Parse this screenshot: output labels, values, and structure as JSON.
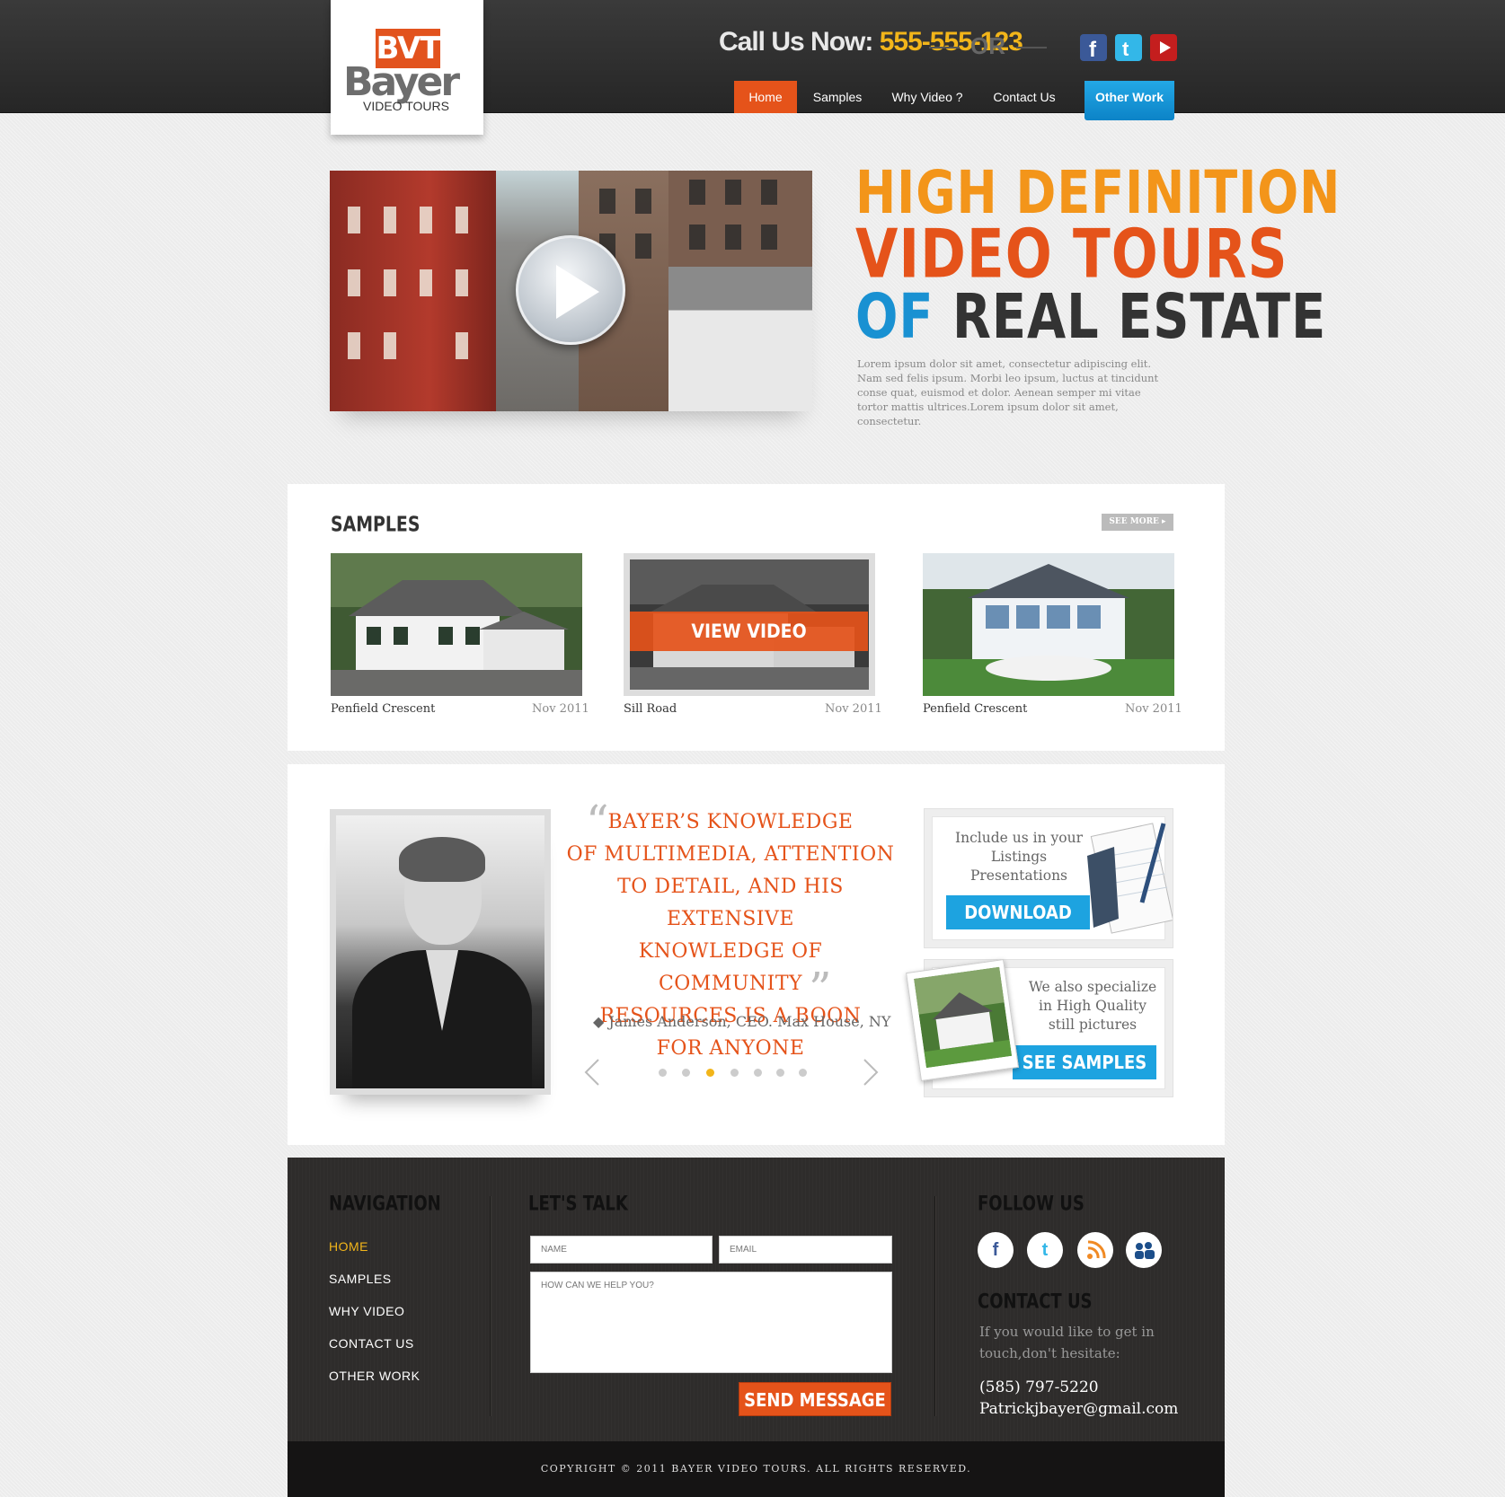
{
  "brand": {
    "logo_mark": "BVT",
    "logo_name": "Bayer",
    "logo_sub": "VIDEO TOURS"
  },
  "header": {
    "call_label": "Call Us Now:",
    "call_number": "555-555-123",
    "or_label": "OR",
    "social": [
      "facebook-icon",
      "twitter-icon",
      "youtube-icon"
    ]
  },
  "nav": {
    "items": [
      "Home",
      "Samples",
      "Why Video ?",
      "Contact Us",
      "Other Work"
    ],
    "active": "Home"
  },
  "hero": {
    "line1": "HIGH DEFINITION",
    "line2": "VIDEO TOURS",
    "line3_a": "OF",
    "line3_b": "REAL ESTATE",
    "text": "Lorem ipsum dolor sit amet, consectetur adipiscing elit. Nam sed felis ipsum. Morbi leo ipsum, luctus at tincidunt conse quat, euismod et dolor. Aenean semper mi vitae tortor mattis ultrices.Lorem ipsum dolor sit amet, consectetur."
  },
  "samples": {
    "title": "SAMPLES",
    "see_more": "SEE MORE",
    "view_video": "VIEW VIDEO",
    "items": [
      {
        "name": "Penfield Crescent",
        "date": "Nov 2011"
      },
      {
        "name": "Sill Road",
        "date": "Nov 2011"
      },
      {
        "name": "Penfield Crescent",
        "date": "Nov 2011"
      }
    ]
  },
  "testimonial": {
    "lines": [
      "BAYER’S KNOWLEDGE",
      "OF MULTIMEDIA, ATTENTION",
      "TO DETAIL, AND HIS EXTENSIVE",
      "KNOWLEDGE OF COMMUNITY",
      "RESOURCES IS A BOON",
      "FOR ANYONE"
    ],
    "author": "James Anderson, CEO. Max House, NY",
    "slide_count": 7,
    "active_slide": 3
  },
  "promos": {
    "download_text": "Include us in your Listings Presentations",
    "download_button": "DOWNLOAD",
    "stills_text": "We also specialize in High Quality still pictures",
    "stills_button": "SEE SAMPLES"
  },
  "footer": {
    "nav_title": "NAVIGATION",
    "nav_items": [
      "HOME",
      "SAMPLES",
      "WHY VIDEO",
      "CONTACT US",
      "OTHER WORK"
    ],
    "talk_title": "LET'S TALK",
    "name_placeholder": "NAME",
    "email_placeholder": "EMAIL",
    "message_placeholder": "HOW CAN WE HELP YOU?",
    "send_label": "SEND MESSAGE",
    "follow_title": "FOLLOW US",
    "follow_icons": [
      "facebook-icon",
      "twitter-icon",
      "rss-icon",
      "myspace-icon"
    ],
    "contact_title": "CONTACT US",
    "contact_text": "If you would like to get in touch,don't hesitate:",
    "phone": "(585) 797-5220",
    "email": "Patrickjbayer@gmail.com",
    "copyright": "COPYRIGHT © 2011 BAYER VIDEO TOURS. ALL RIGHTS RESERVED."
  },
  "colors": {
    "orange": "#e5531a",
    "gold": "#f2b51a",
    "blue": "#1da3e0",
    "dark": "#2e2c2b"
  }
}
